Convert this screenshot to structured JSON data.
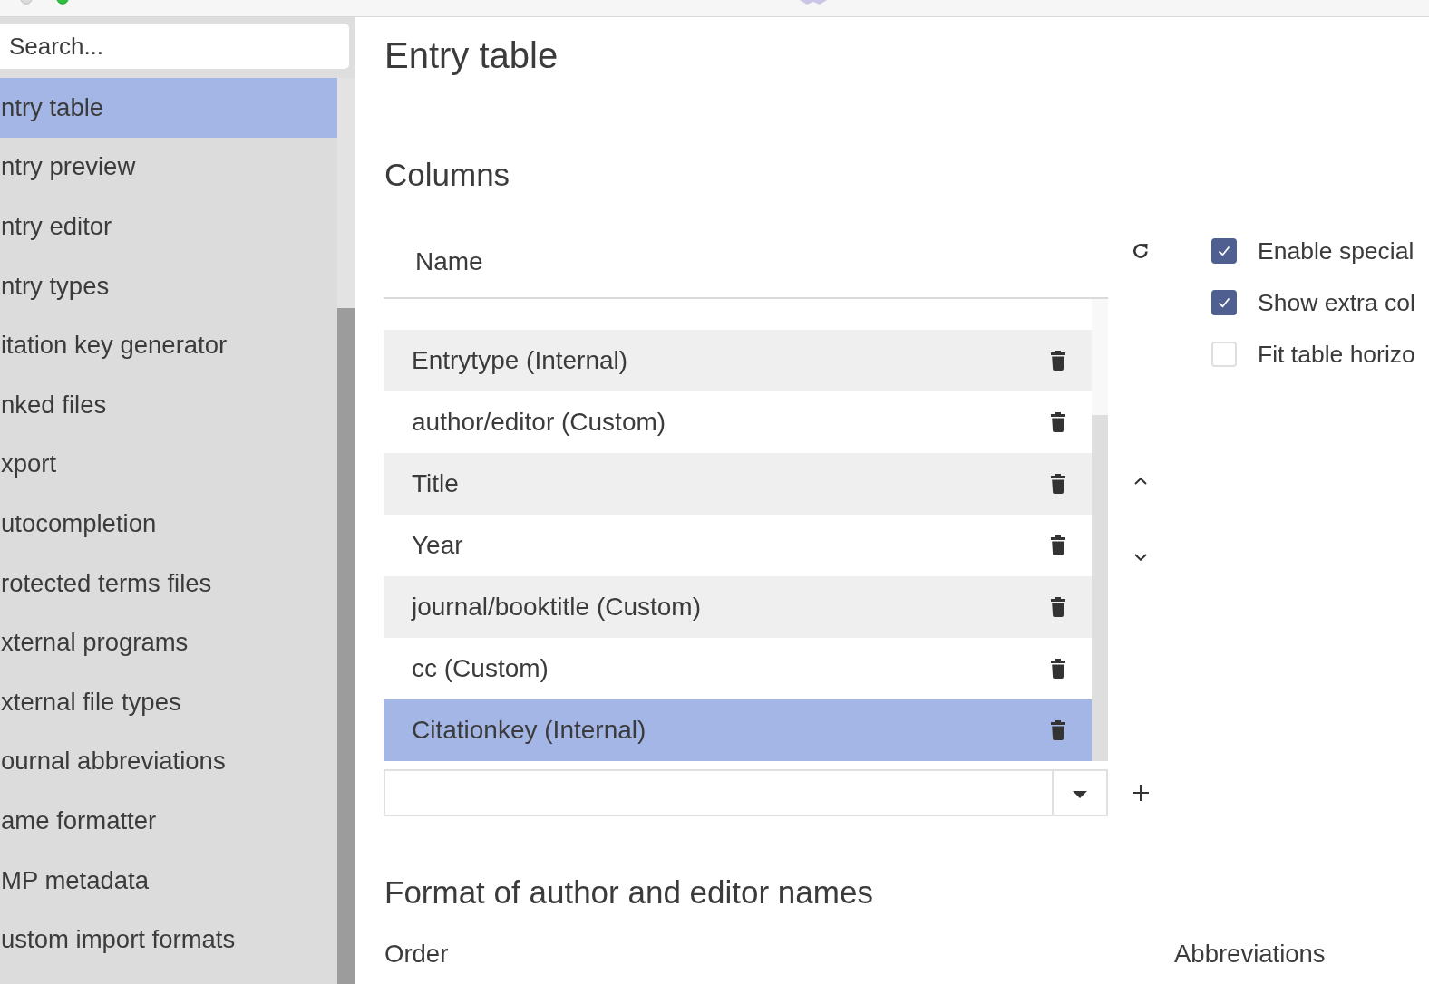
{
  "sidebar": {
    "search": {
      "placeholder": "Search..."
    },
    "items": [
      {
        "label": "ntry table",
        "selected": true
      },
      {
        "label": "ntry preview",
        "selected": false
      },
      {
        "label": "ntry editor",
        "selected": false
      },
      {
        "label": "ntry types",
        "selected": false
      },
      {
        "label": "itation key generator",
        "selected": false
      },
      {
        "label": "nked files",
        "selected": false
      },
      {
        "label": "xport",
        "selected": false
      },
      {
        "label": "utocompletion",
        "selected": false
      },
      {
        "label": "rotected terms files",
        "selected": false
      },
      {
        "label": "xternal programs",
        "selected": false
      },
      {
        "label": "xternal file types",
        "selected": false
      },
      {
        "label": "ournal abbreviations",
        "selected": false
      },
      {
        "label": "ame formatter",
        "selected": false
      },
      {
        "label": "MP metadata",
        "selected": false
      },
      {
        "label": "ustom import formats",
        "selected": false
      }
    ]
  },
  "page": {
    "title": "Entry table"
  },
  "columns": {
    "heading": "Columns",
    "table": {
      "header": "Name",
      "rows": [
        {
          "name": "Entrytype (Internal)",
          "selected": false
        },
        {
          "name": "author/editor (Custom)",
          "selected": false
        },
        {
          "name": "Title",
          "selected": false
        },
        {
          "name": "Year",
          "selected": false
        },
        {
          "name": "journal/booktitle (Custom)",
          "selected": false
        },
        {
          "name": "cc (Custom)",
          "selected": false
        },
        {
          "name": "Citationkey (Internal)",
          "selected": true
        }
      ]
    },
    "checkboxes": [
      {
        "label": "Enable special",
        "checked": true
      },
      {
        "label": "Show extra col",
        "checked": true
      },
      {
        "label": "Fit table horizo",
        "checked": false
      }
    ]
  },
  "name_format": {
    "heading": "Format of author and editor names",
    "order_label": "Order",
    "abbreviations_label": "Abbreviations"
  }
}
